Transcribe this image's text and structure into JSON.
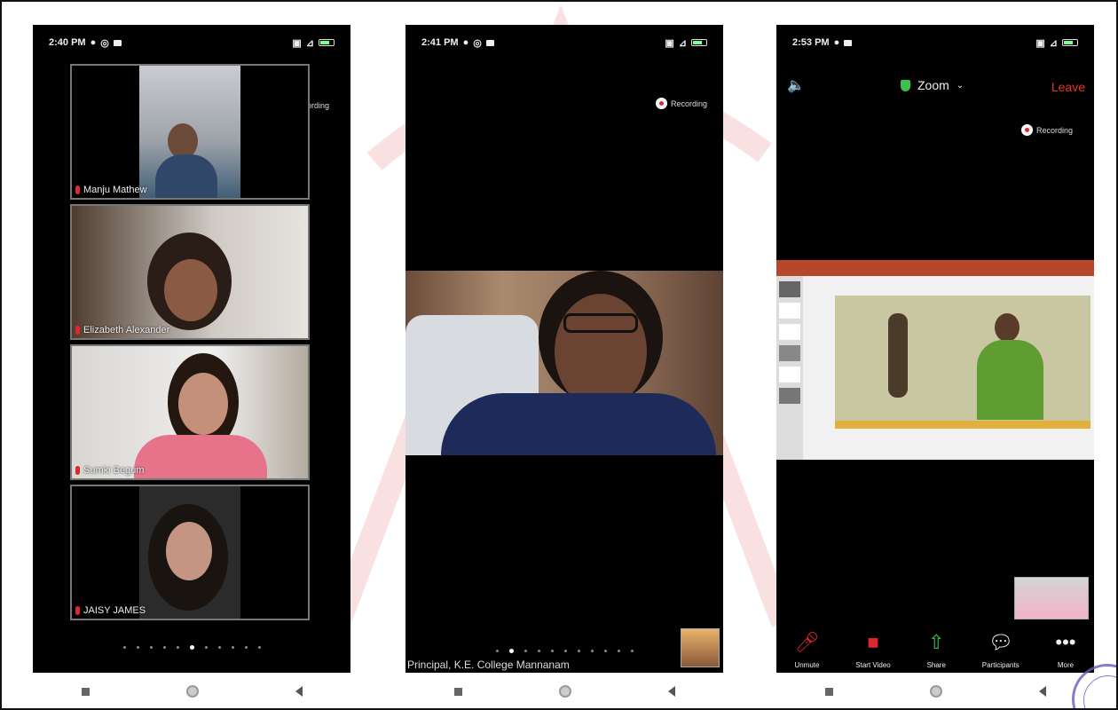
{
  "phone1": {
    "status": {
      "time": "2:40 PM"
    },
    "recording": "Recording",
    "participants": [
      {
        "name": "Manju Mathew"
      },
      {
        "name": "Elizabeth Alexander"
      },
      {
        "name": "Sumki Begum"
      },
      {
        "name": "JAISY JAMES"
      }
    ]
  },
  "phone2": {
    "status": {
      "time": "2:41 PM"
    },
    "recording": "Recording",
    "speaker_name": "Principal, K.E. College Mannanam"
  },
  "phone3": {
    "status": {
      "time": "2:53 PM"
    },
    "meeting_title": "Zoom",
    "leave": "Leave",
    "recording": "Recording",
    "toolbar": {
      "unmute": "Unmute",
      "start_video": "Start Video",
      "share": "Share",
      "participants": "Participants",
      "more": "More"
    }
  },
  "colors": {
    "record_red": "#e0262f",
    "leave_red": "#e8322d",
    "shield_green": "#3ac24a"
  }
}
